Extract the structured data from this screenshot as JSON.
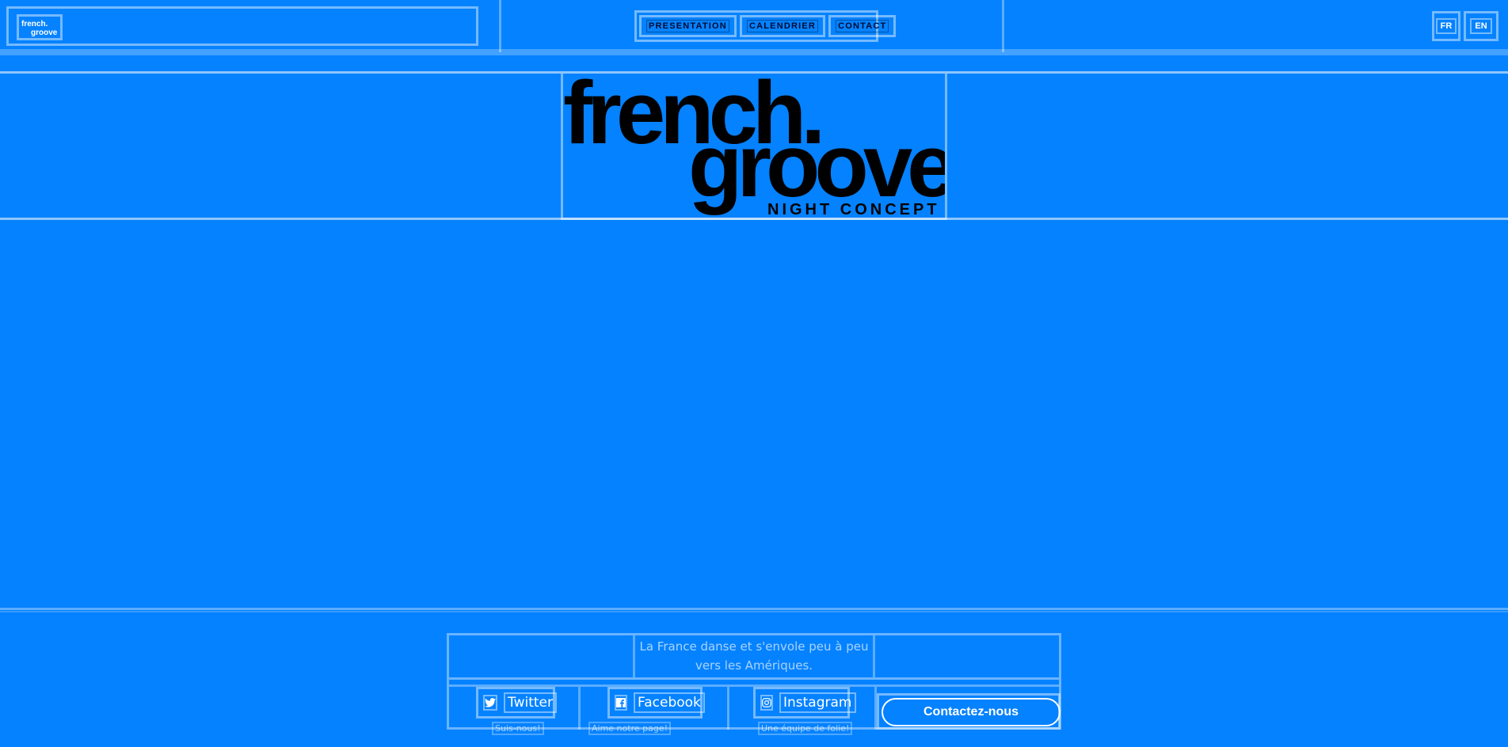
{
  "header": {
    "logo_alt": "french groove",
    "nav": [
      {
        "label": "PRESENTATION"
      },
      {
        "label": "CALENDRIER"
      },
      {
        "label": "CONTACT"
      }
    ],
    "langs": [
      {
        "label": "FR"
      },
      {
        "label": "EN"
      }
    ]
  },
  "hero": {
    "logo_line1": "french.",
    "logo_line2": "groove",
    "logo_line3": "NIGHT CONCEPT"
  },
  "footer": {
    "tagline": "La France danse et s'envole peu à peu vers les Amériques.",
    "socials": [
      {
        "label": "Twitter",
        "sub": "Suis-nous!",
        "icon": "twitter-icon"
      },
      {
        "label": "Facebook",
        "sub": "Aime notre page!",
        "icon": "facebook-icon"
      },
      {
        "label": "Instagram",
        "sub": "Une équipe de folie!",
        "icon": "instagram-icon"
      }
    ],
    "contact_label": "Contactez-nous"
  },
  "colors": {
    "background": "#0582ff",
    "logo": "#000000",
    "text_light": "#ffffff"
  }
}
